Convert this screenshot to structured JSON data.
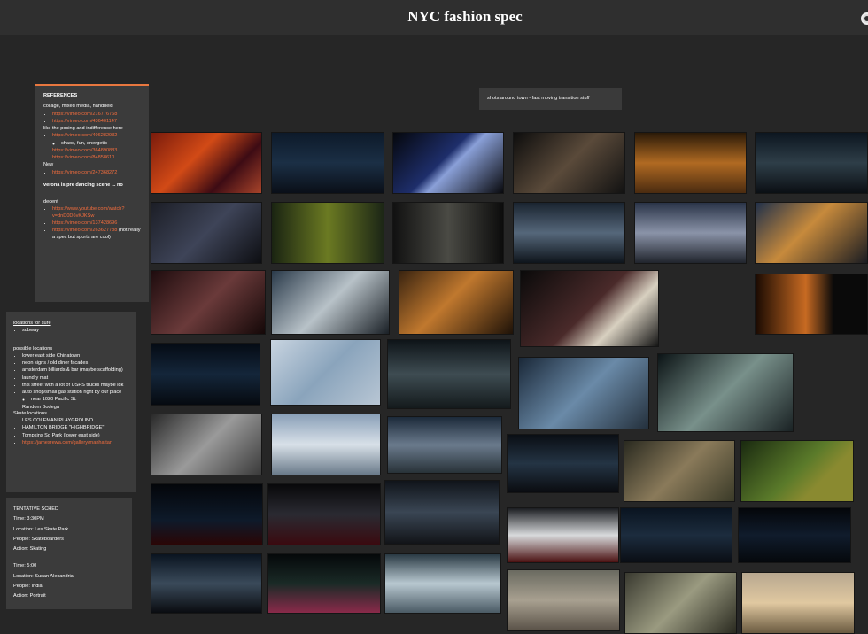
{
  "board_title": "NYC fashion spec",
  "references": {
    "heading": "REFERENCES",
    "line1": "collage, mixed media, handheld",
    "link1": "https://vimeo.com/216776768",
    "link2": "https://vimeo.com/436401147",
    "line2": "like the posing and indifference here",
    "link3": "https://vimeo.com/406282932",
    "sub1": "chaos, fun, energetic",
    "link4": "https://vimeo.com/364890883",
    "link5": "https://vimeo.com/84858610",
    "line3": "New",
    "link6": "https://vimeo.com/247368272",
    "line4": "verona is pre dancing scene ... no",
    "line5": "decent",
    "link7": "https://www.youtube.com/watch?v=dnD0D6vKJKSw",
    "link8": "https://vimeo.com/137428696",
    "link9": "https://vimeo.com/263627788",
    "link9_note": "(not really a spec but sports are cool)"
  },
  "locations": {
    "heading": "locations for sure",
    "for_sure": [
      "subway"
    ],
    "possible_heading": "possible locations",
    "possible": [
      "lower east side Chinatown",
      "neon signs / old diner facades",
      "amsterdam billiards & bar (maybe scaffolding)",
      "laundry mat",
      "this street with a lot of USPS trucks maybe idk",
      "auto shop/small gas station right by our place"
    ],
    "possible_sub": "near 1020 Pacific St.",
    "possible_more": [
      "Random Bodega"
    ],
    "skate_heading": "Skate locations",
    "skate": [
      "LES COLEMAN PLAYGROUND",
      "HAMILTON BRIDGE \"HIGHBRIDGE\"",
      "Tompkins Sq Park (lower east side)"
    ],
    "skate_link": "https://jamesrewa.com/gallery/manhattan"
  },
  "schedule": {
    "heading": "TENTATIVE SCHED",
    "block1": [
      "Time: 3:30PM",
      "Location: Les Skate Park",
      "People: Skateboarders",
      "Action: Skating"
    ],
    "block2": [
      "Time: 5:00",
      "Location: Susan Alexandria",
      "People: India",
      "Action: Portrait"
    ]
  },
  "note": "shots around town - fast moving transition stuff",
  "colors": {
    "background": "#262626",
    "card": "#3b3b3b",
    "accent": "#e8773f",
    "link": "#f36d3d"
  }
}
